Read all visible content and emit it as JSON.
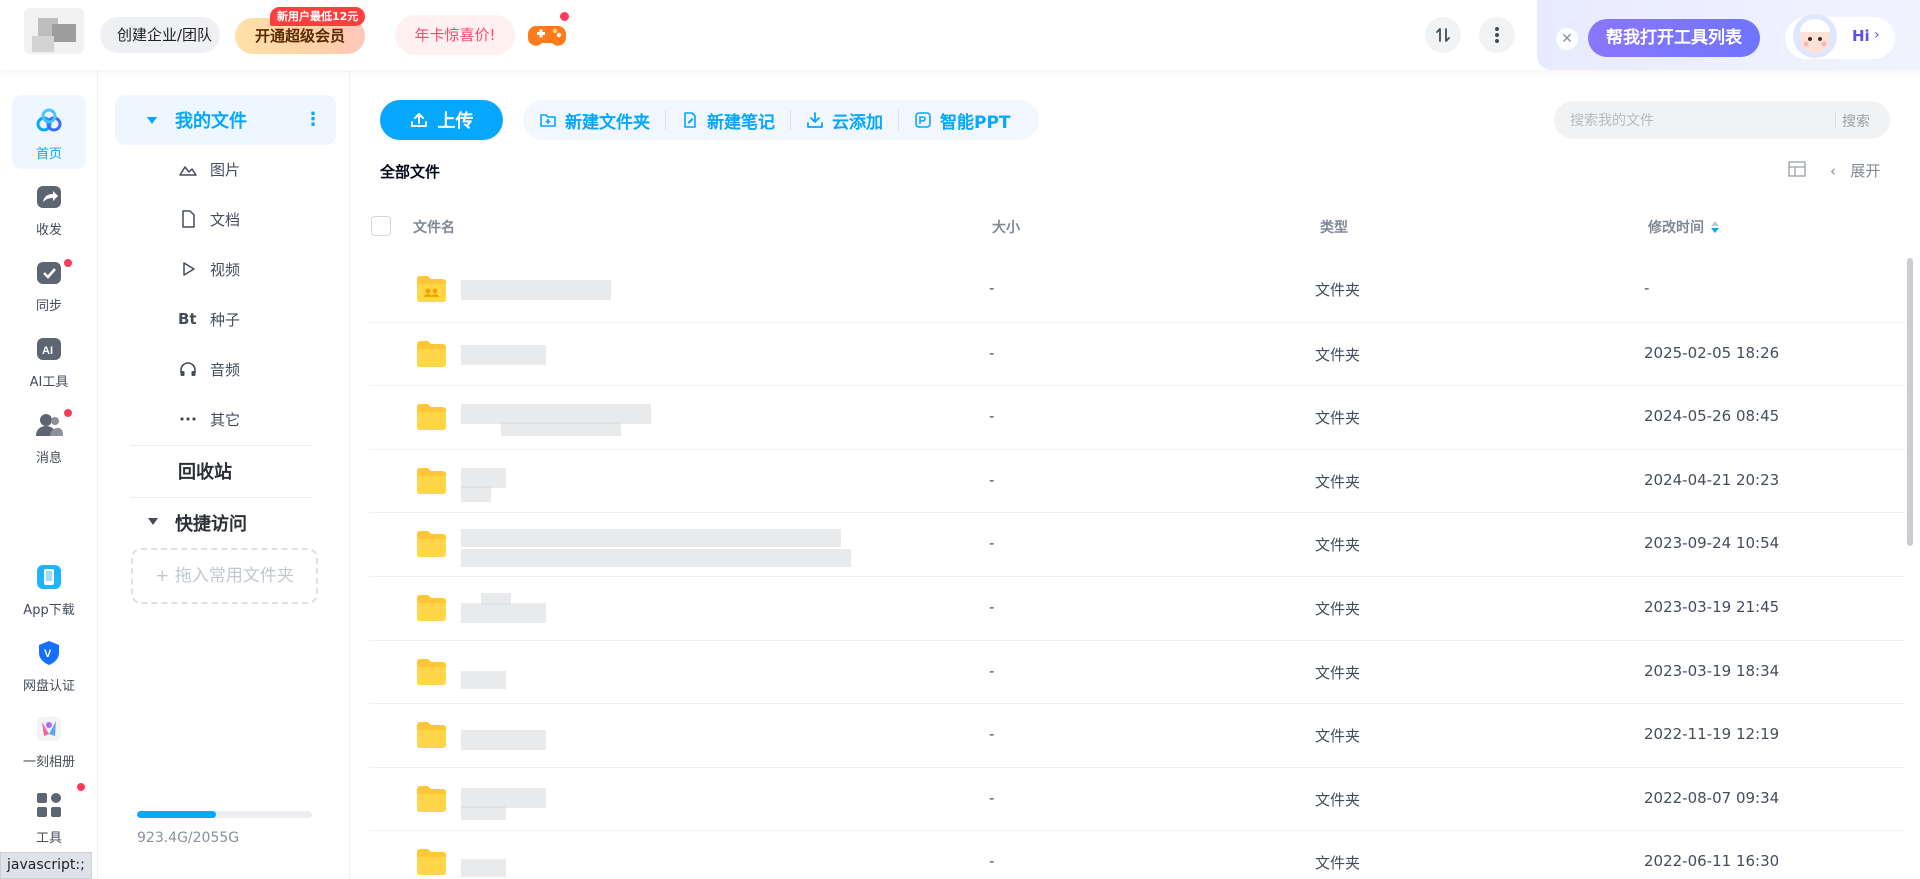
{
  "topbar": {
    "org_label": "创建企业/团队",
    "vip_label": "开通超级会员",
    "vip_badge": "新用户最低12元",
    "annual_label": "年卡惊喜价!",
    "tool_list_label": "帮我打开工具列表",
    "hi_label": "Hi",
    "close_label": "✕"
  },
  "rail": {
    "items": [
      {
        "label": "首页",
        "icon": "home-cloud-icon"
      },
      {
        "label": "收发",
        "icon": "share-icon"
      },
      {
        "label": "同步",
        "icon": "sync-icon"
      },
      {
        "label": "AI工具",
        "icon": "ai-icon"
      },
      {
        "label": "消息",
        "icon": "message-icon"
      },
      {
        "label": "App下载",
        "icon": "phone-icon"
      },
      {
        "label": "网盘认证",
        "icon": "verify-icon"
      },
      {
        "label": "一刻相册",
        "icon": "album-icon"
      },
      {
        "label": "工具",
        "icon": "tools-icon"
      }
    ]
  },
  "sidebar": {
    "my_files": "我的文件",
    "sub_items": [
      {
        "label": "图片",
        "icon": "image-icon"
      },
      {
        "label": "文档",
        "icon": "document-icon"
      },
      {
        "label": "视频",
        "icon": "video-icon"
      },
      {
        "label": "种子",
        "icon": "torrent-icon",
        "glyph": "Bt"
      },
      {
        "label": "音频",
        "icon": "audio-icon"
      },
      {
        "label": "其它",
        "icon": "more-icon"
      }
    ],
    "recycle": "回收站",
    "quick_access": "快捷访问",
    "drag_hint": "+ 拖入常用文件夹",
    "storage_text": "923.4G/2055G",
    "storage_used_fraction": 0.449
  },
  "toolbar": {
    "upload": "上传",
    "actions": [
      {
        "label": "新建文件夹",
        "icon": "new-folder-icon"
      },
      {
        "label": "新建笔记",
        "icon": "new-note-icon"
      },
      {
        "label": "云添加",
        "icon": "cloud-download-icon"
      },
      {
        "label": "智能PPT",
        "icon": "smart-ppt-icon"
      }
    ],
    "search_placeholder": "搜索我的文件",
    "search_button": "搜索"
  },
  "breadcrumb": "全部文件",
  "view": {
    "expand_label": "展开"
  },
  "table": {
    "columns": {
      "name": "文件名",
      "size": "大小",
      "type": "类型",
      "mtime": "修改时间"
    },
    "rows": [
      {
        "size": "-",
        "type": "文件夹",
        "mtime": "-",
        "shared": true
      },
      {
        "size": "-",
        "type": "文件夹",
        "mtime": "2025-02-05 18:26"
      },
      {
        "size": "-",
        "type": "文件夹",
        "mtime": "2024-05-26 08:45"
      },
      {
        "size": "-",
        "type": "文件夹",
        "mtime": "2024-04-21 20:23"
      },
      {
        "size": "-",
        "type": "文件夹",
        "mtime": "2023-09-24 10:54"
      },
      {
        "size": "-",
        "type": "文件夹",
        "mtime": "2023-03-19 21:45"
      },
      {
        "size": "-",
        "type": "文件夹",
        "mtime": "2023-03-19 18:34"
      },
      {
        "size": "-",
        "type": "文件夹",
        "mtime": "2022-11-19 12:19"
      },
      {
        "size": "-",
        "type": "文件夹",
        "mtime": "2022-08-07 09:34"
      },
      {
        "size": "-",
        "type": "文件夹",
        "mtime": "2022-06-11 16:30"
      }
    ]
  },
  "status_bar": "javascript:;",
  "colors": {
    "accent": "#06a7ff",
    "folder": "#ffc736",
    "badge": "#ff3b5c"
  }
}
